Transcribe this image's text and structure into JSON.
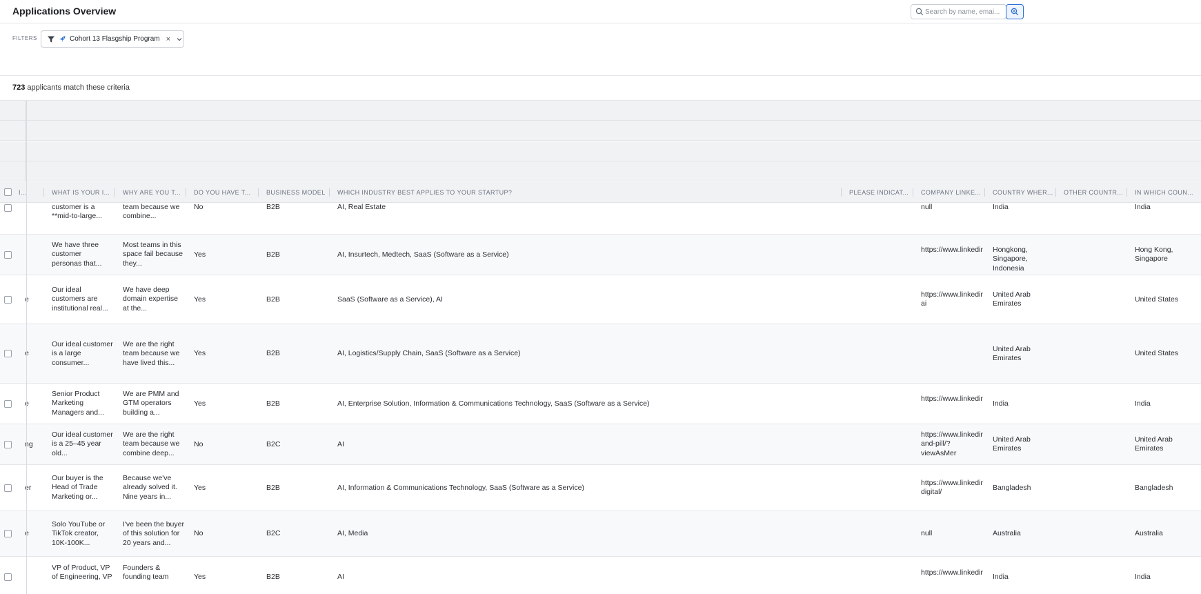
{
  "header": {
    "title": "Applications Overview",
    "search_placeholder": "Search by name, emai..."
  },
  "filters": {
    "label": "FILTERS",
    "chip_label": "Cohort 13 Flasgship Program",
    "chip_remove": "×"
  },
  "summary": {
    "count": "723",
    "text": "applicants match these criteria"
  },
  "columns": [
    "I...",
    "WHAT IS YOUR I...",
    "WHY ARE YOU T...",
    "DO YOU HAVE T...",
    "BUSINESS MODEL",
    "WHICH INDUSTRY BEST APPLIES TO YOUR STARTUP?",
    "PLEASE INDICAT...",
    "COMPANY LINKE...",
    "COUNTRY WHER...",
    "OTHER COUNTR...",
    "IN WHICH COUN..."
  ],
  "rows": [
    {
      "c0": "",
      "c1": "customer is a **mid-to-large...",
      "c2": "team because we combine...",
      "c3": "No",
      "c4": "B2B",
      "c5": "AI, Real Estate",
      "c6": "",
      "c7": "null",
      "c8": "India",
      "c9": "",
      "c10": "India"
    },
    {
      "c0": "",
      "c1": "We have three customer personas that...",
      "c2": "Most teams in this space fail because they...",
      "c3": "Yes",
      "c4": "B2B",
      "c5": "AI, Insurtech, Medtech, SaaS (Software as a Service)",
      "c6": "",
      "c7": "https://www.linkedin",
      "c8": "Hongkong, Singapore, Indonesia",
      "c9": "",
      "c10": "Hong Kong, Singapore"
    },
    {
      "c0": "e",
      "c1": "Our ideal customers are institutional real...",
      "c2": "We have deep domain expertise at the...",
      "c3": "Yes",
      "c4": "B2B",
      "c5": "SaaS (Software as a Service), AI",
      "c6": "",
      "c7": "https://www.linkedin ai",
      "c8": "United Arab Emirates",
      "c9": "",
      "c10": "United States"
    },
    {
      "c0": "e",
      "c1": "Our ideal customer is a large consumer...",
      "c2": "We are the right team because we have lived this...",
      "c3": "Yes",
      "c4": "B2B",
      "c5": "AI, Logistics/Supply Chain, SaaS (Software as a Service)",
      "c6": "",
      "c7": "",
      "c8": "United Arab Emirates",
      "c9": "",
      "c10": "United States"
    },
    {
      "c0": "e",
      "c1": "Senior Product Marketing Managers and...",
      "c2": "We are PMM and GTM operators building a...",
      "c3": "Yes",
      "c4": "B2B",
      "c5": "AI, Enterprise Solution, Information & Communications Technology, SaaS (Software as a Service)",
      "c6": "",
      "c7": "https://www.linkedin",
      "c8": "India",
      "c9": "",
      "c10": "India"
    },
    {
      "c0": "ng",
      "c1": "Our ideal customer is a 25–45 year old...",
      "c2": "We are the right team because we combine deep...",
      "c3": "No",
      "c4": "B2C",
      "c5": "AI",
      "c6": "",
      "c7": "https://www.linkedin and-pill/?viewAsMer",
      "c8": "United Arab Emirates",
      "c9": "",
      "c10": "United Arab Emirates"
    },
    {
      "c0": "er",
      "c1": "Our buyer is the Head of Trade Marketing or...",
      "c2": "Because we've already solved it. Nine years in...",
      "c3": "Yes",
      "c4": "B2B",
      "c5": "AI, Information & Communications Technology, SaaS (Software as a Service)",
      "c6": "",
      "c7": "https://www.linkedin digital/",
      "c8": "Bangladesh",
      "c9": "",
      "c10": "Bangladesh"
    },
    {
      "c0": "e",
      "c1": "Solo YouTube or TikTok creator, 10K-100K...",
      "c2": "I've been the buyer of this solution for 20 years and...",
      "c3": "No",
      "c4": "B2C",
      "c5": "AI, Media",
      "c6": "",
      "c7": "null",
      "c8": "Australia",
      "c9": "",
      "c10": "Australia"
    },
    {
      "c0": "",
      "c1": "VP of Product, VP of Engineering, VP",
      "c2": "Founders & founding team",
      "c3": "Yes",
      "c4": "B2B",
      "c5": "AI",
      "c6": "",
      "c7": "https://www.linkedin",
      "c8": "India",
      "c9": "",
      "c10": "India"
    }
  ]
}
